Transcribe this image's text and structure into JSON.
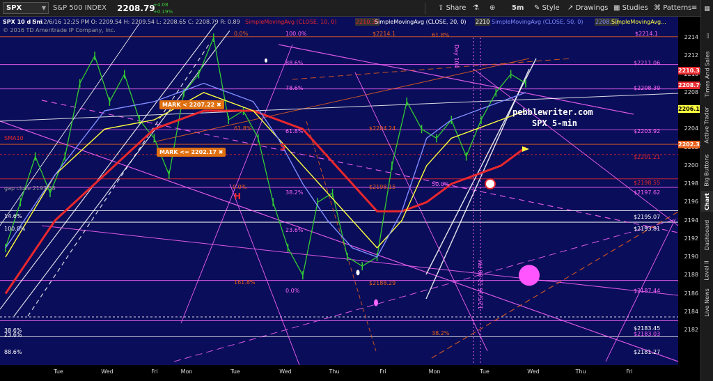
{
  "toolbar": {
    "symbol": "SPX",
    "name": "S&P 500 INDEX",
    "price": "2208.79",
    "change": "+4.08",
    "change_pct": "+0.19%",
    "share_label": "Share",
    "timeframe": "5m",
    "style_label": "Style",
    "drawings_label": "Drawings",
    "studies_label": "Studies",
    "patterns_label": "Patterns"
  },
  "header": {
    "chart_label": "SPX 10 d 5m",
    "ohlc": "D: 12/6/16 12:25 PM  O: 2209.54  H: 2209.54  L: 2208.65  C: 2208.79  R: 0.89",
    "copyright": "© 2016 TD Ameritrade IP Company, Inc.",
    "studies": [
      {
        "label": "SimpleMovingAvg (CLOSE, 10, 0)",
        "value": "2210.35",
        "color": "#e8282d"
      },
      {
        "label": "SimpleMovingAvg (CLOSE, 20, 0)",
        "value": "2210",
        "color": "#ffffff"
      },
      {
        "label": "SimpleMovingAvg (CLOSE, 50, 0)",
        "value": "2208.52",
        "color": "#7f8cff"
      },
      {
        "label": "SimpleMovingAvg...",
        "value": "",
        "color": "#ffff40"
      }
    ]
  },
  "annotations": {
    "watermark_line1": "pebblewriter.com",
    "watermark_line2": "SPX 5-min",
    "mark1": "MARK < 2207.22",
    "mark2": "MARK <= 2202.17",
    "left_h": "H",
    "s_label": "S",
    "sma10": "SMA10",
    "gap_close": "gap close 2197.38",
    "day104": "Day 104",
    "date_text": "12/5/16 12:00 PM",
    "fib_0_top": "0.0%",
    "fib_100_top": "100.0%",
    "fib_618_top": "61.8%",
    "fib_886": "88.6%",
    "fib_786": "78.6%",
    "fib_618a": "61.8%",
    "fib_618b": "61.8%",
    "fib_0_h": "0.0%",
    "fib_382": "38.2%",
    "fib_500": "50.0%",
    "fib_236": "23.6%",
    "fib_1618": "161.8%",
    "fib_0_low": "0.0%",
    "fib_146": "14.6%",
    "fib_100_left": "100.0%",
    "fib_386": "38.6%",
    "fib_236_low": "23.6%",
    "fib_886_low": "88.6%",
    "fib_382_low": "38.2%",
    "lvl_22141": "$2214.1",
    "lvl_22141r": "$2214.1",
    "lvl_221106": "$2211.06",
    "lvl_220839": "$2208.39",
    "lvl_220424": "$2204.24",
    "lvl_220392": "$2203.92",
    "lvl_220121": "$2201.21",
    "lvl_219855": "$2198.55",
    "lvl_219815": "$2198.15",
    "lvl_219762": "$2197.62",
    "lvl_219507": "$2195.07",
    "lvl_219381": "$2193.81",
    "lvl_218829": "$2188.29",
    "lvl_218744": "$2187.44",
    "lvl_218345": "$2183.45",
    "lvl_218303": "$2183.03",
    "lvl_218127": "$2181.27"
  },
  "price_tags": [
    {
      "text": "2210.35",
      "price": 2210.35,
      "bg": "#e8282d",
      "fg": "#ffffff"
    },
    {
      "text": "2208.79",
      "price": 2208.79,
      "bg": "#e8282d",
      "fg": "#ffffff"
    },
    {
      "text": "2206.18",
      "price": 2206.18,
      "bg": "#ffff40",
      "fg": "#000000"
    },
    {
      "text": "2202.33",
      "price": 2202.33,
      "bg": "#e8601c",
      "fg": "#ffffff"
    }
  ],
  "sidebar_tabs": [
    "Times And Sales",
    "Active Trader",
    "Big Buttons",
    "Chart",
    "Dashboard",
    "Level II",
    "Live News"
  ],
  "sidebar_active": "Chart",
  "chart_data": {
    "type": "line",
    "title": "SPX 10 d 5m",
    "xlabel": "",
    "ylabel": "",
    "ylim": [
      2180,
      2216
    ],
    "y_ticks": [
      2182,
      2184,
      2186,
      2188,
      2190,
      2192,
      2194,
      2196,
      2198,
      2200,
      2202,
      2204,
      2206,
      2208,
      2210,
      2212,
      2214
    ],
    "x_ticks": [
      "Tue",
      "Wed",
      "Fri",
      "Mon",
      "Tue",
      "Wed",
      "Thu",
      "Fri",
      "Mon",
      "Tue",
      "Wed",
      "Thu",
      "Fri"
    ],
    "series": [
      {
        "name": "SPX close",
        "color": "#33cc33",
        "x": [
          0,
          3,
          6,
          9,
          12,
          15,
          18,
          21,
          24,
          27,
          30,
          33,
          36,
          39,
          42,
          45,
          48,
          51,
          54,
          57,
          60,
          63,
          66,
          69,
          72,
          75,
          78,
          81,
          84,
          87,
          90,
          93,
          96,
          99,
          102,
          105
        ],
        "y": [
          2191,
          2196,
          2201,
          2197,
          2201,
          2209,
          2212,
          2207,
          2210,
          2205,
          2203,
          2199,
          2208,
          2210,
          2214,
          2205,
          2206,
          2203,
          2196,
          2191,
          2188,
          2196,
          2197,
          2190,
          2189,
          2190,
          2200,
          2207,
          2204,
          2203,
          2205,
          2201,
          2205,
          2208,
          2210,
          2209
        ]
      },
      {
        "name": "SMA 10",
        "color": "#e8282d",
        "x": [
          0,
          10,
          20,
          30,
          40,
          50,
          55,
          60,
          65,
          70,
          75,
          80,
          85,
          90,
          95,
          100,
          105
        ],
        "y": [
          2186,
          2194,
          2199,
          2204,
          2206,
          2206,
          2205,
          2204,
          2201,
          2198,
          2195,
          2195,
          2196,
          2198,
          2199,
          2200,
          2202
        ]
      },
      {
        "name": "SMA 20",
        "color": "#ffff40",
        "x": [
          0,
          10,
          20,
          30,
          40,
          50,
          55,
          60,
          65,
          70,
          75,
          80,
          85,
          90,
          95,
          100,
          105
        ],
        "y": [
          2190,
          2199,
          2204,
          2205,
          2208,
          2206,
          2203,
          2200,
          2197,
          2194,
          2191,
          2194,
          2200,
          2203,
          2204,
          2205,
          2206
        ]
      },
      {
        "name": "SMA 50",
        "color": "#7f8cff",
        "x": [
          0,
          10,
          20,
          30,
          40,
          50,
          55,
          60,
          65,
          70,
          75,
          80,
          85,
          90,
          95,
          100,
          105
        ],
        "y": [
          2191,
          2199,
          2206,
          2207,
          2209,
          2207,
          2203,
          2198,
          2194,
          2191,
          2190,
          2195,
          2203,
          2205,
          2206,
          2207,
          2208
        ]
      }
    ]
  }
}
